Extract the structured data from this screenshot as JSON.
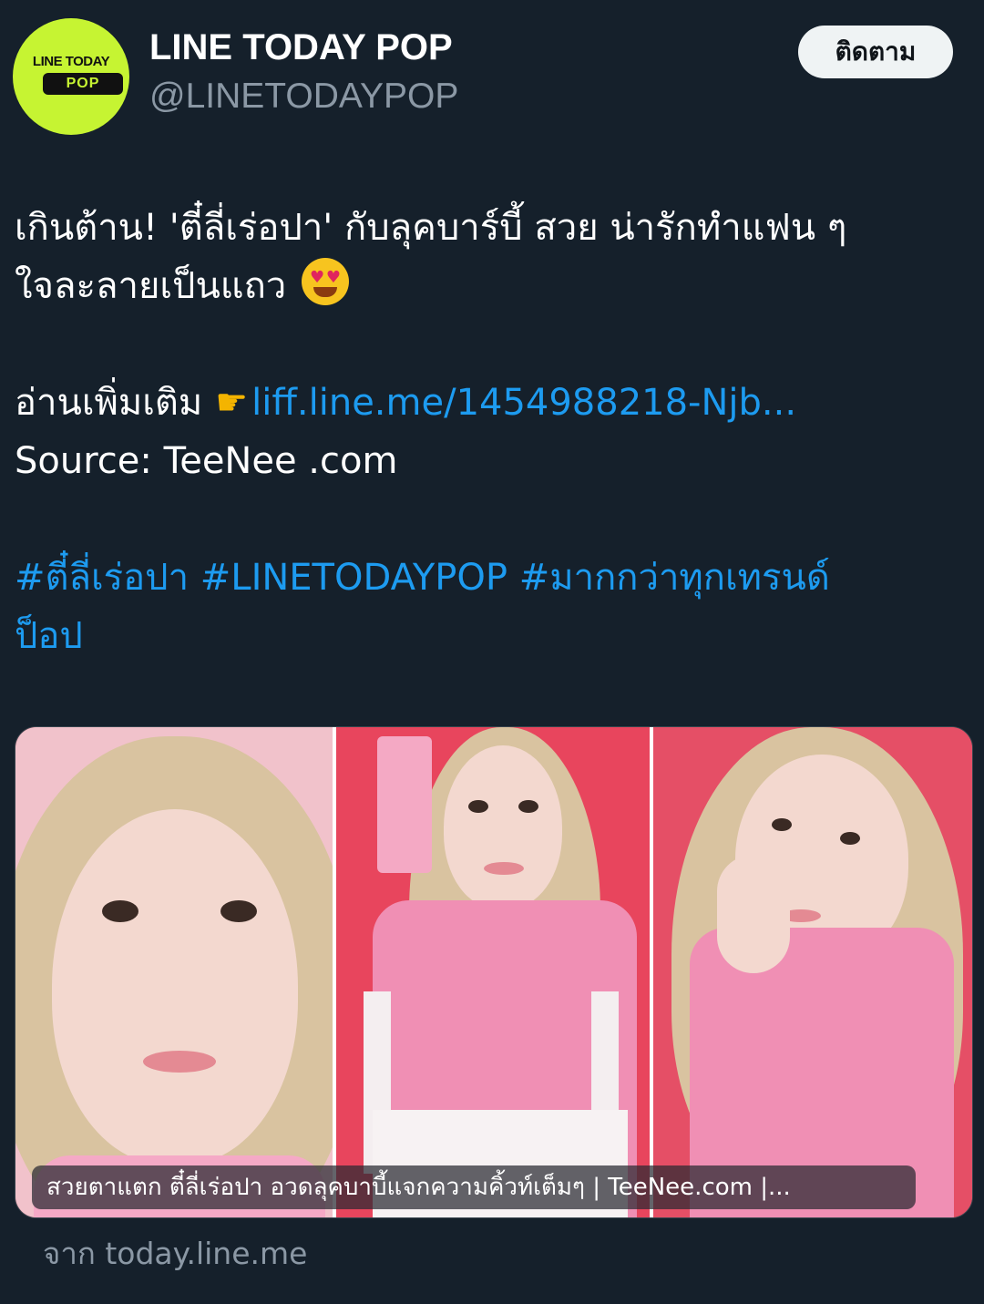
{
  "account": {
    "display_name": "LINE TODAY POP",
    "handle": "@LINETODAYPOP",
    "logo_line": "LINE TODAY",
    "logo_pop": "POP",
    "avatar_color": "#c6f432"
  },
  "follow_button": {
    "label": "ติดตาม"
  },
  "tweet": {
    "line1": "เกินต้าน! 'ตี๋ลี่เร่อปา' กับลุคบาร์บี้ สวย น่ารักทำแฟน ๆ",
    "line2": "ใจละลายเป็นแถว",
    "emoji_icon": "heart-eyes-emoji",
    "read_more_label": "อ่านเพิ่มเติม",
    "pointing_icon": "pointing-right-hand-emoji",
    "read_more_link": "liff.line.me/1454988218-Njb...",
    "source": "Source: TeeNee .com",
    "hashtags": [
      "#ตี๋ลี่เร่อปา",
      "#LINETODAYPOP",
      "#มากกว่าทุกเทรนด์"
    ],
    "hashtags_wrap": "ป็อป",
    "link_color": "#1d9bf0"
  },
  "media_card": {
    "caption": "สวยตาแตก ตี๋ลี่เร่อปา อวดลุคบาบี้แจกความคิ้วท์เต็มๆ | TeeNee.com |...",
    "panels": [
      "portrait-closeup-photo",
      "portrait-phone-photo",
      "portrait-hand-photo"
    ]
  },
  "from_line": "จาก today.line.me",
  "colors": {
    "background": "#15202b",
    "secondary_text": "#8b98a5",
    "pink": "#f08fb4"
  }
}
